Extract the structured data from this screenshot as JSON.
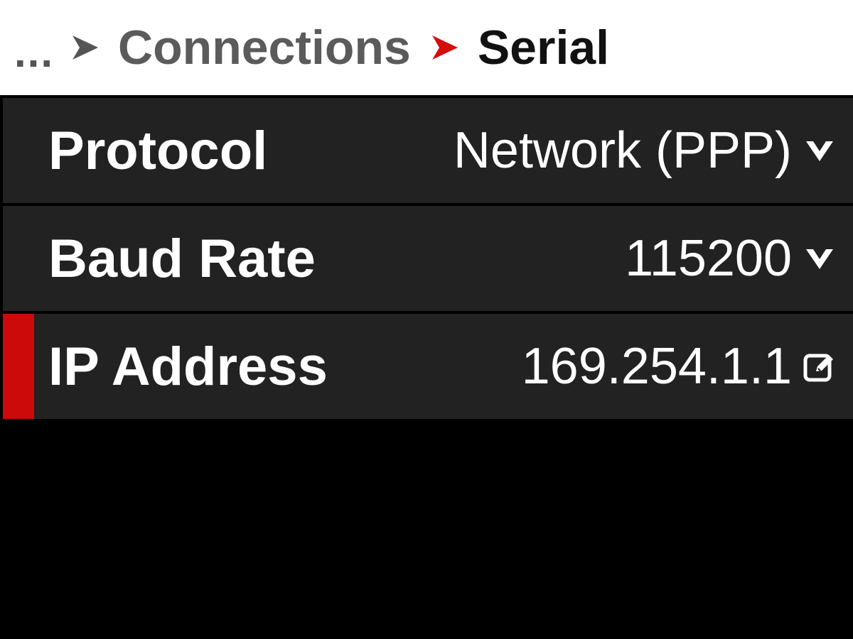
{
  "breadcrumb": {
    "ellipsis": "...",
    "parent": "Connections",
    "current": "Serial",
    "separator_icon": "chevron-right-icon",
    "colors": {
      "parent_separator": "#555555",
      "current_separator": "#d40d0d"
    }
  },
  "settings": [
    {
      "label": "Protocol",
      "value": "Network (PPP)",
      "icon": "dropdown-arrow-icon",
      "selected": false
    },
    {
      "label": "Baud Rate",
      "value": "115200",
      "icon": "dropdown-arrow-icon",
      "selected": false
    },
    {
      "label": "IP Address",
      "value": "169.254.1.1",
      "icon": "edit-icon",
      "selected": true
    }
  ],
  "colors": {
    "background": "#000000",
    "row_background": "#222222",
    "selection_accent": "#cc0a0a",
    "header_background": "#ffffff"
  }
}
